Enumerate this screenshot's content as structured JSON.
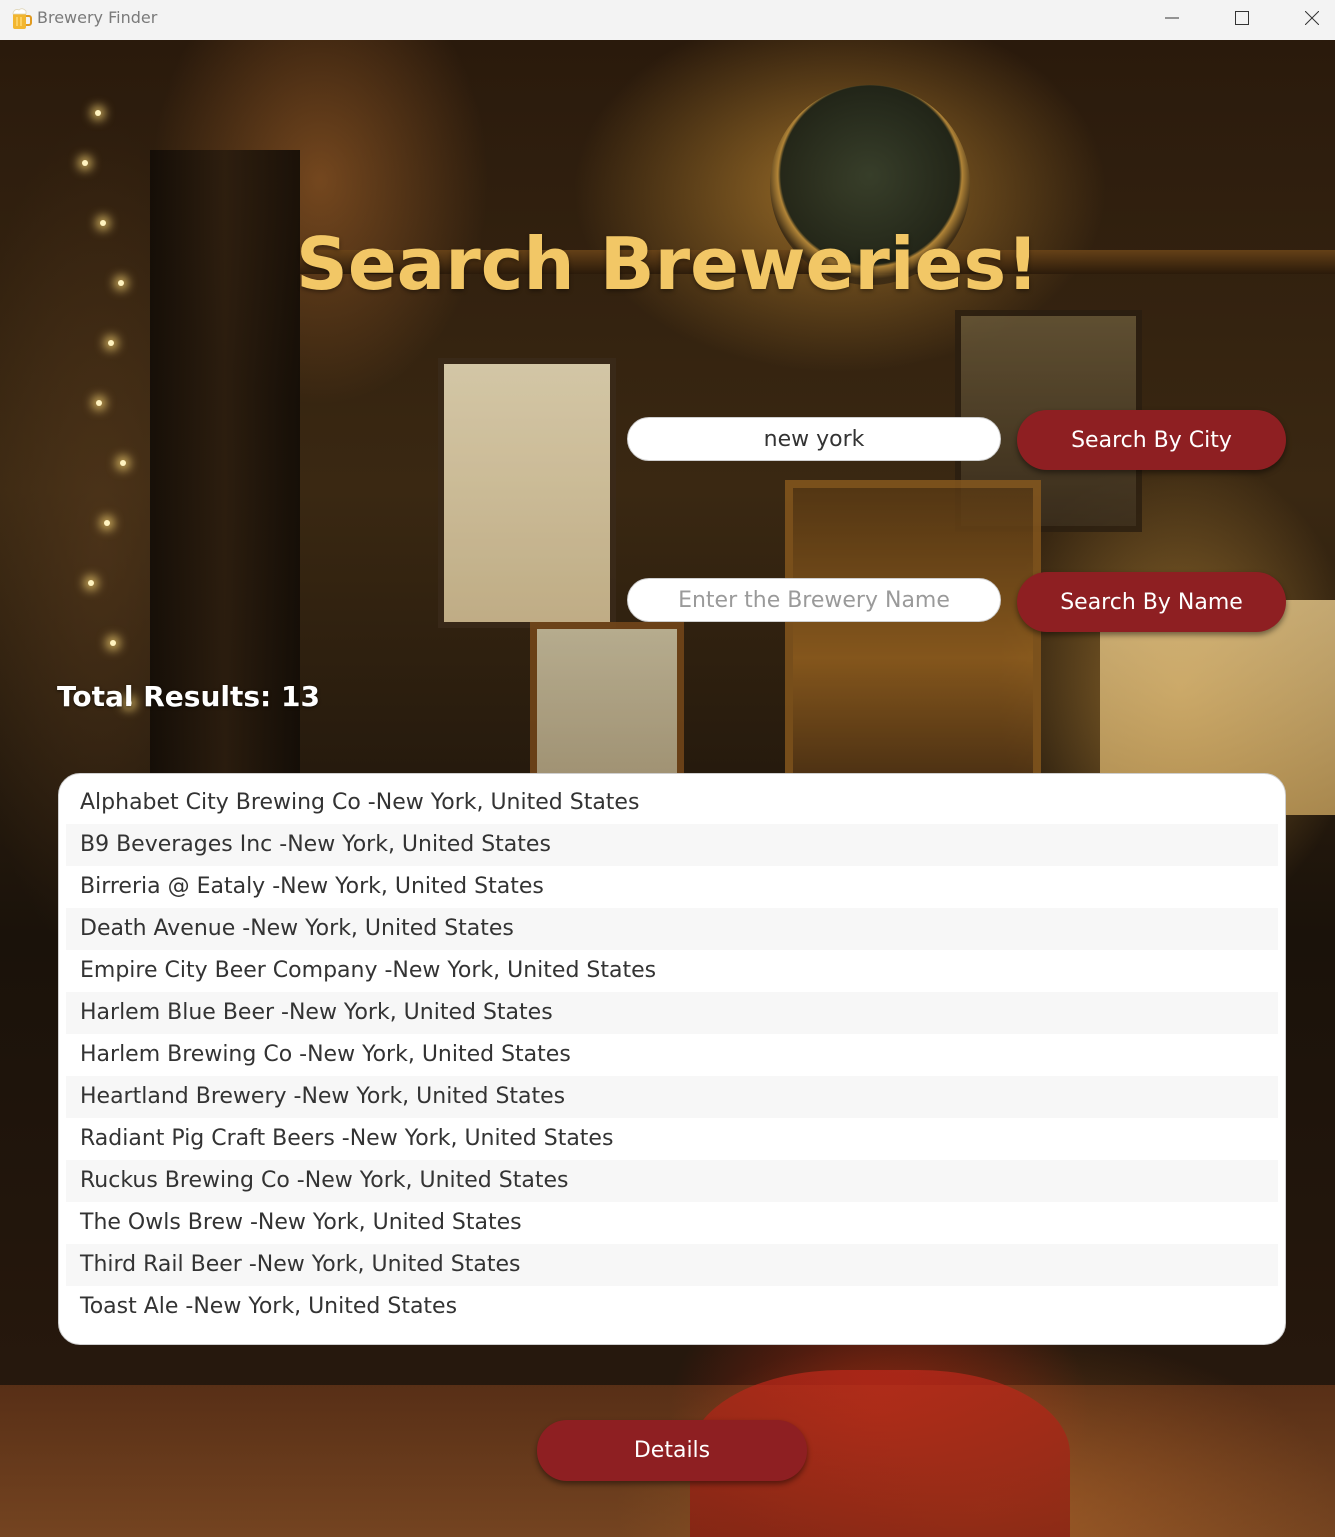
{
  "window": {
    "title": "Brewery Finder",
    "app_icon": "beer-mug-icon",
    "controls": [
      "minimize-icon",
      "maximize-icon",
      "close-icon"
    ]
  },
  "heading": "Search Breweries!",
  "city_search": {
    "value": "new york",
    "button_label": "Search By City"
  },
  "name_search": {
    "value": "",
    "placeholder": "Enter the Brewery Name",
    "button_label": "Search By Name"
  },
  "total_results": "Total Results: 13",
  "results": [
    "Alphabet City Brewing Co -New York, United States",
    "B9 Beverages Inc -New York, United States",
    "Birreria @ Eataly -New York, United States",
    "Death Avenue -New York, United States",
    "Empire City Beer Company -New York, United States",
    "Harlem Blue Beer -New York, United States",
    "Harlem Brewing Co -New York, United States",
    "Heartland Brewery -New York, United States",
    "Radiant Pig Craft Beers -New York, United States",
    "Ruckus Brewing Co -New York, United States",
    "The Owls Brew -New York, United States",
    "Third Rail Beer -New York, United States",
    "Toast Ale -New York, United States"
  ],
  "details_label": "Details",
  "colors": {
    "heading": "#f2c766",
    "button": "#8e1f22",
    "button_text": "#ffffff",
    "list_text": "#333333"
  }
}
